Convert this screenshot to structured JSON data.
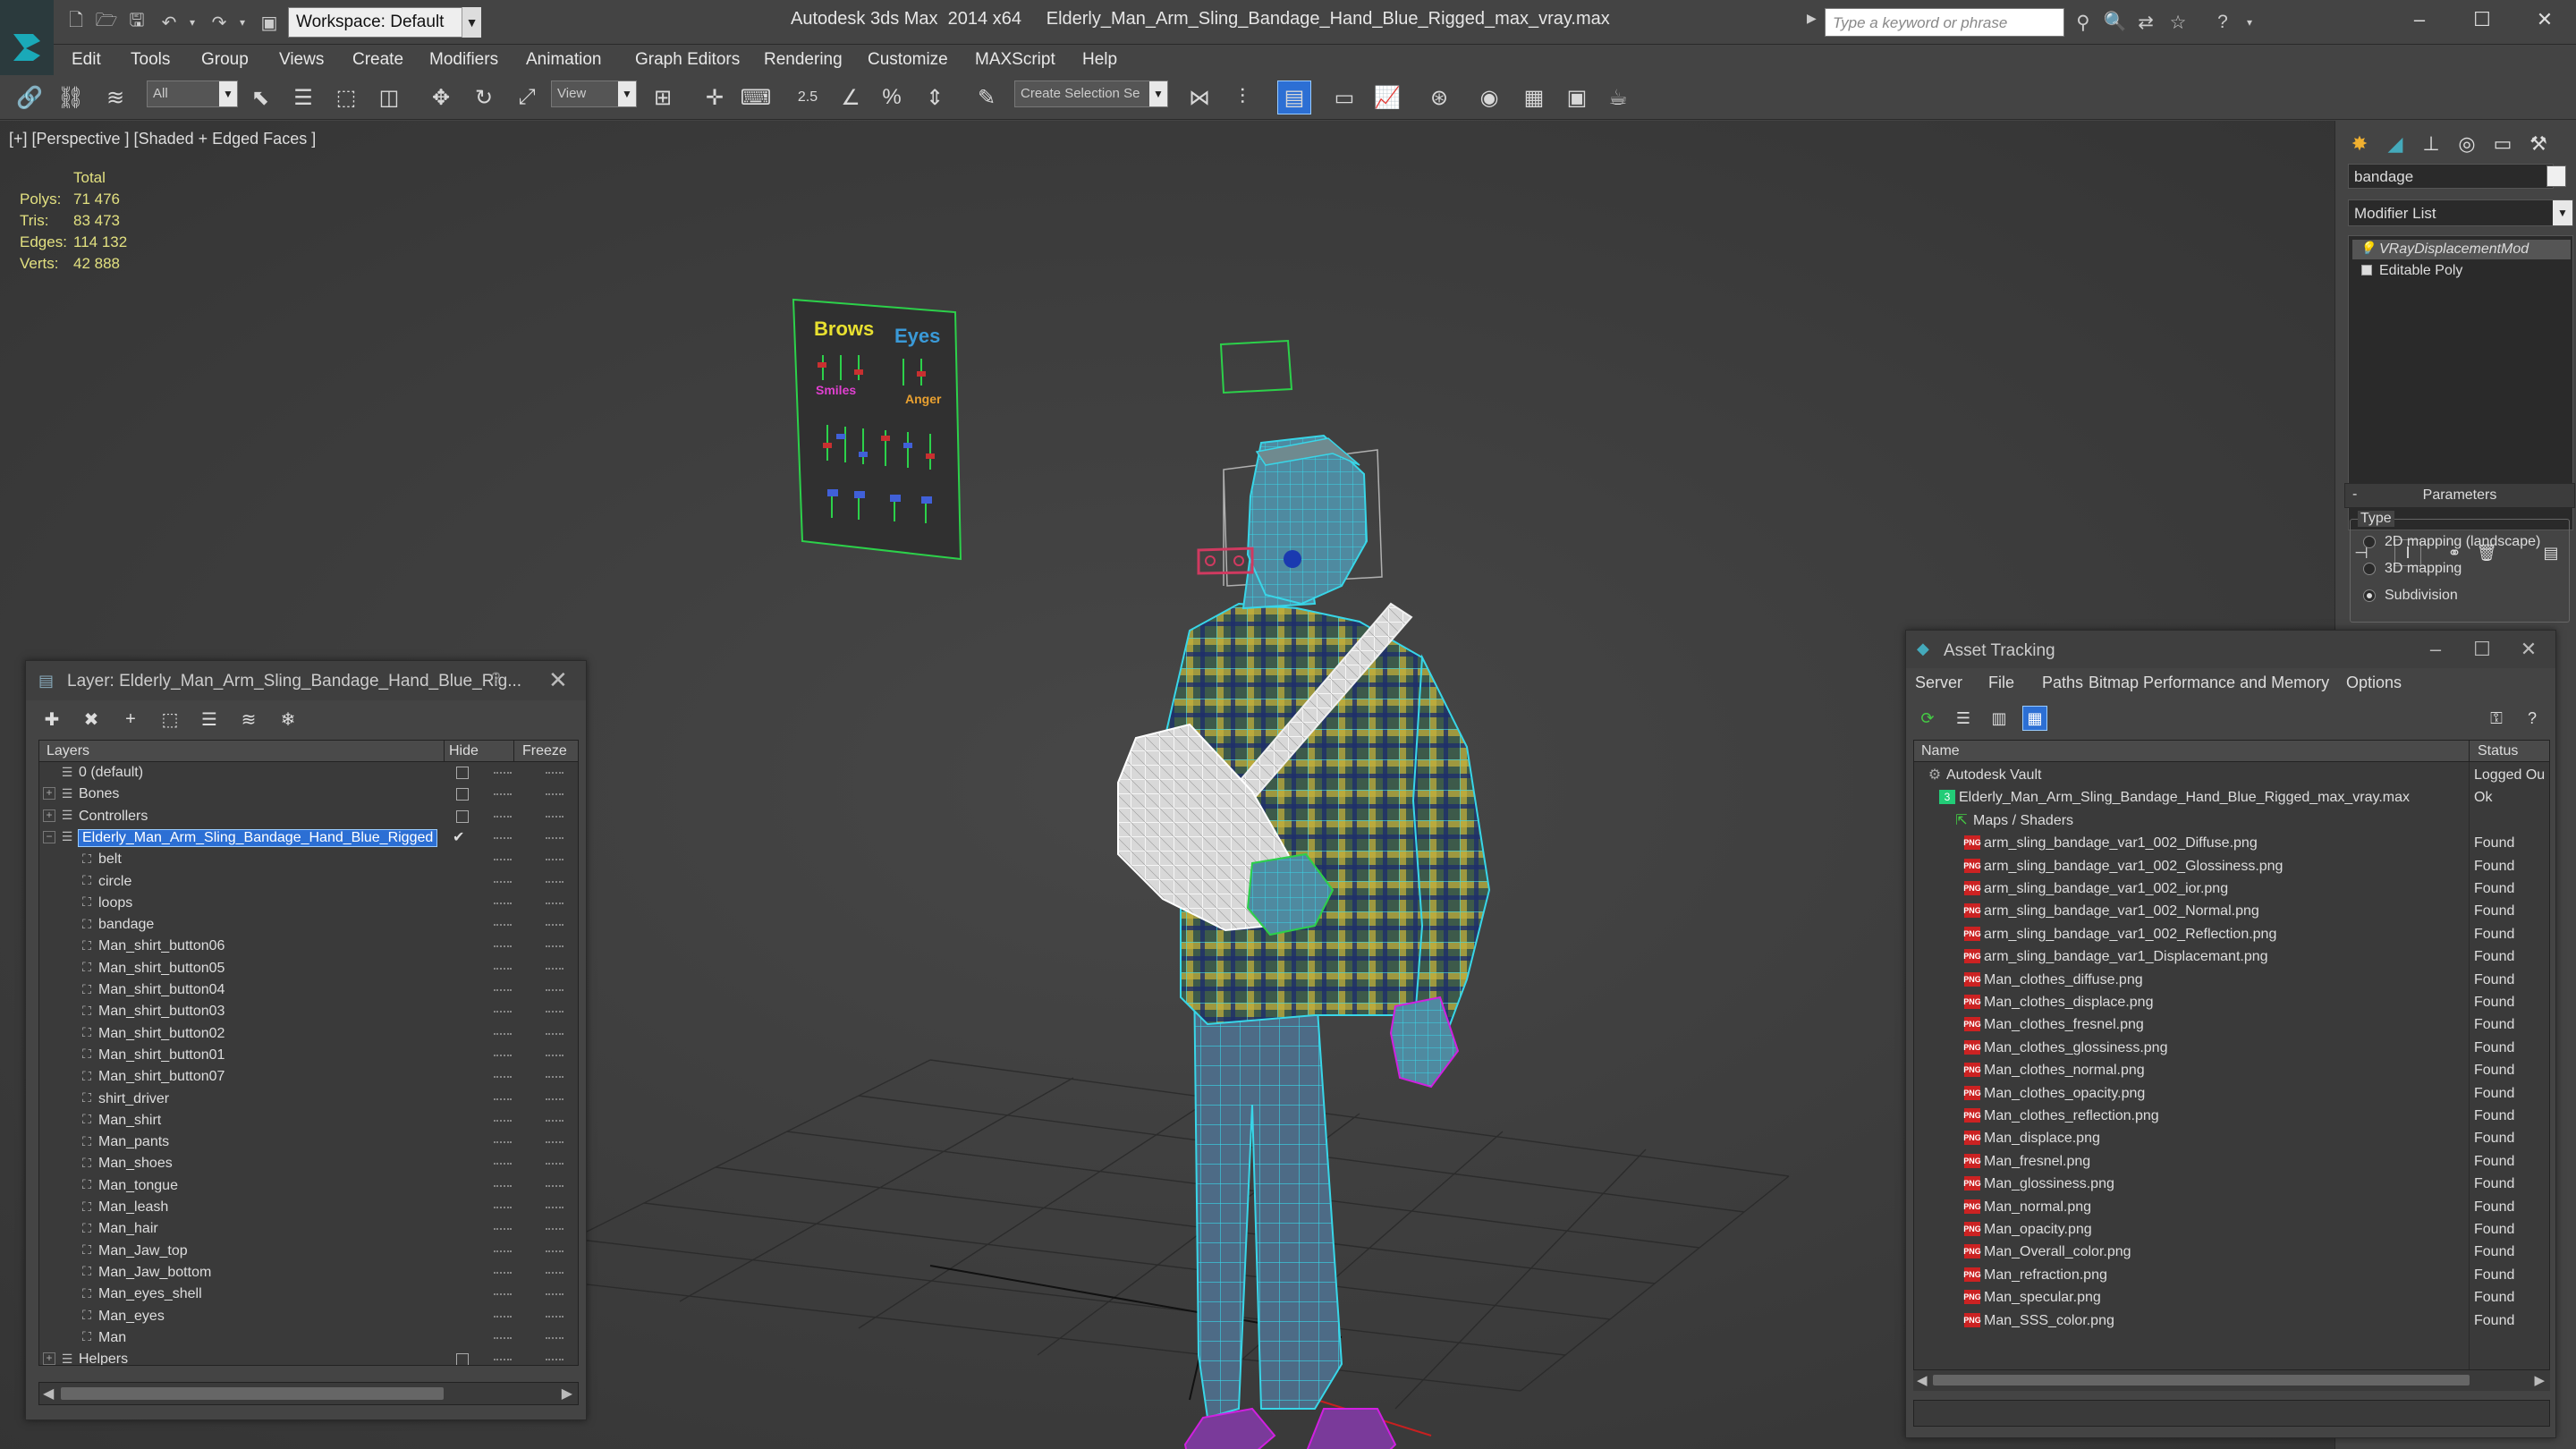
{
  "app": {
    "title": "Autodesk 3ds Max  2014 x64     Elderly_Man_Arm_Sling_Bandage_Hand_Blue_Rigged_max_vray.max",
    "workspace": "Workspace: Default",
    "search_placeholder": "Type a keyword or phrase"
  },
  "menu": [
    "Edit",
    "Tools",
    "Group",
    "Views",
    "Create",
    "Modifiers",
    "Animation",
    "Graph Editors",
    "Rendering",
    "Customize",
    "MAXScript",
    "Help"
  ],
  "toolbar": {
    "filter_value": "All",
    "refcoord_value": "View",
    "snap_value": "2.5",
    "selection_set_value": "Create Selection Se"
  },
  "viewport": {
    "label": "[+] [Perspective ] [Shaded + Edged Faces ]",
    "stats": {
      "header": "Total",
      "rows": [
        {
          "label": "Polys:",
          "value": "71 476"
        },
        {
          "label": "Tris:",
          "value": "83 473"
        },
        {
          "label": "Edges:",
          "value": "114 132"
        },
        {
          "label": "Verts:",
          "value": "42 888"
        }
      ]
    },
    "facial_board": {
      "brows": "Brows",
      "eyes": "Eyes",
      "smiles": "Smiles",
      "anger": "Anger"
    }
  },
  "command_panel": {
    "object_name": "bandage",
    "modifier_list": "Modifier List",
    "stack": [
      "VRayDisplacementMod",
      "Editable Poly"
    ],
    "params_title": "Parameters",
    "type_label": "Type",
    "type_options": [
      {
        "label": "2D mapping (landscape)",
        "selected": false
      },
      {
        "label": "3D mapping",
        "selected": false
      },
      {
        "label": "Subdivision",
        "selected": true
      }
    ]
  },
  "layer_window": {
    "title": "Layer: Elderly_Man_Arm_Sling_Bandage_Hand_Blue_Rig...",
    "help": "?",
    "columns": {
      "layers": "Layers",
      "hide": "Hide",
      "freeze": "Freeze"
    },
    "rows": [
      {
        "name": "0 (default)",
        "level": 0,
        "expander": "",
        "type": "layer",
        "hide_box": true,
        "selected": false
      },
      {
        "name": "Bones",
        "level": 0,
        "expander": "+",
        "type": "layer",
        "hide_box": true,
        "selected": false
      },
      {
        "name": "Controllers",
        "level": 0,
        "expander": "+",
        "type": "layer",
        "hide_box": true,
        "selected": false
      },
      {
        "name": "Elderly_Man_Arm_Sling_Bandage_Hand_Blue_Rigged",
        "level": 0,
        "expander": "−",
        "type": "layer",
        "hide_box": false,
        "selected": true,
        "checked": true
      },
      {
        "name": "belt",
        "level": 1,
        "type": "object"
      },
      {
        "name": "circle",
        "level": 1,
        "type": "object"
      },
      {
        "name": "loops",
        "level": 1,
        "type": "object"
      },
      {
        "name": "bandage",
        "level": 1,
        "type": "object"
      },
      {
        "name": "Man_shirt_button06",
        "level": 1,
        "type": "object"
      },
      {
        "name": "Man_shirt_button05",
        "level": 1,
        "type": "object"
      },
      {
        "name": "Man_shirt_button04",
        "level": 1,
        "type": "object"
      },
      {
        "name": "Man_shirt_button03",
        "level": 1,
        "type": "object"
      },
      {
        "name": "Man_shirt_button02",
        "level": 1,
        "type": "object"
      },
      {
        "name": "Man_shirt_button01",
        "level": 1,
        "type": "object"
      },
      {
        "name": "Man_shirt_button07",
        "level": 1,
        "type": "object"
      },
      {
        "name": "shirt_driver",
        "level": 1,
        "type": "object"
      },
      {
        "name": "Man_shirt",
        "level": 1,
        "type": "object"
      },
      {
        "name": "Man_pants",
        "level": 1,
        "type": "object"
      },
      {
        "name": "Man_shoes",
        "level": 1,
        "type": "object"
      },
      {
        "name": "Man_tongue",
        "level": 1,
        "type": "object"
      },
      {
        "name": "Man_leash",
        "level": 1,
        "type": "object"
      },
      {
        "name": "Man_hair",
        "level": 1,
        "type": "object"
      },
      {
        "name": "Man_Jaw_top",
        "level": 1,
        "type": "object"
      },
      {
        "name": "Man_Jaw_bottom",
        "level": 1,
        "type": "object"
      },
      {
        "name": "Man_eyes_shell",
        "level": 1,
        "type": "object"
      },
      {
        "name": "Man_eyes",
        "level": 1,
        "type": "object"
      },
      {
        "name": "Man",
        "level": 1,
        "type": "object"
      },
      {
        "name": "Helpers",
        "level": 0,
        "expander": "+",
        "type": "layer",
        "hide_box": true,
        "selected": false
      }
    ]
  },
  "asset_window": {
    "title": "Asset Tracking",
    "menu": [
      "Server",
      "File",
      "Paths",
      "Bitmap Performance and Memory",
      "Options"
    ],
    "columns": {
      "name": "Name",
      "status": "Status"
    },
    "rows": [
      {
        "name": "Autodesk Vault",
        "status": "Logged Ou",
        "level": 0,
        "icon": "vault"
      },
      {
        "name": "Elderly_Man_Arm_Sling_Bandage_Hand_Blue_Rigged_max_vray.max",
        "status": "Ok",
        "level": 1,
        "icon": "max"
      },
      {
        "name": "Maps / Shaders",
        "status": "",
        "level": 2,
        "icon": "maps"
      },
      {
        "name": "arm_sling_bandage_var1_002_Diffuse.png",
        "status": "Found",
        "level": 3,
        "icon": "png"
      },
      {
        "name": "arm_sling_bandage_var1_002_Glossiness.png",
        "status": "Found",
        "level": 3,
        "icon": "png"
      },
      {
        "name": "arm_sling_bandage_var1_002_ior.png",
        "status": "Found",
        "level": 3,
        "icon": "png"
      },
      {
        "name": "arm_sling_bandage_var1_002_Normal.png",
        "status": "Found",
        "level": 3,
        "icon": "png"
      },
      {
        "name": "arm_sling_bandage_var1_002_Reflection.png",
        "status": "Found",
        "level": 3,
        "icon": "png"
      },
      {
        "name": "arm_sling_bandage_var1_Displacemant.png",
        "status": "Found",
        "level": 3,
        "icon": "png"
      },
      {
        "name": "Man_clothes_diffuse.png",
        "status": "Found",
        "level": 3,
        "icon": "png"
      },
      {
        "name": "Man_clothes_displace.png",
        "status": "Found",
        "level": 3,
        "icon": "png"
      },
      {
        "name": "Man_clothes_fresnel.png",
        "status": "Found",
        "level": 3,
        "icon": "png"
      },
      {
        "name": "Man_clothes_glossiness.png",
        "status": "Found",
        "level": 3,
        "icon": "png"
      },
      {
        "name": "Man_clothes_normal.png",
        "status": "Found",
        "level": 3,
        "icon": "png"
      },
      {
        "name": "Man_clothes_opacity.png",
        "status": "Found",
        "level": 3,
        "icon": "png"
      },
      {
        "name": "Man_clothes_reflection.png",
        "status": "Found",
        "level": 3,
        "icon": "png"
      },
      {
        "name": "Man_displace.png",
        "status": "Found",
        "level": 3,
        "icon": "png"
      },
      {
        "name": "Man_fresnel.png",
        "status": "Found",
        "level": 3,
        "icon": "png"
      },
      {
        "name": "Man_glossiness.png",
        "status": "Found",
        "level": 3,
        "icon": "png"
      },
      {
        "name": "Man_normal.png",
        "status": "Found",
        "level": 3,
        "icon": "png"
      },
      {
        "name": "Man_opacity.png",
        "status": "Found",
        "level": 3,
        "icon": "png"
      },
      {
        "name": "Man_Overall_color.png",
        "status": "Found",
        "level": 3,
        "icon": "png"
      },
      {
        "name": "Man_refraction.png",
        "status": "Found",
        "level": 3,
        "icon": "png"
      },
      {
        "name": "Man_specular.png",
        "status": "Found",
        "level": 3,
        "icon": "png"
      },
      {
        "name": "Man_SSS_color.png",
        "status": "Found",
        "level": 3,
        "icon": "png"
      }
    ]
  },
  "colors": {
    "selection": "#2c6fd4",
    "stats_text": "#e2e080",
    "wire_cyan": "#38d6e8",
    "wire_magenta": "#d020e0",
    "png_icon": "#cc2222"
  }
}
